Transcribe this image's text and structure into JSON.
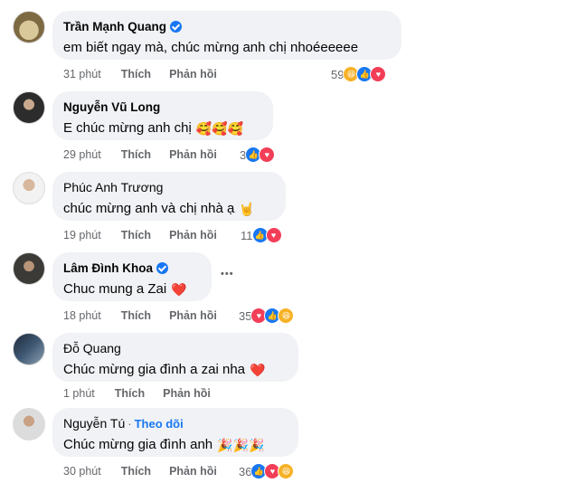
{
  "comments": [
    {
      "name": "Trần Mạnh Quang",
      "verified": true,
      "text": "em biết ngay mà, chúc mừng anh chị nhoéeeeee",
      "emojis": "",
      "time": "31 phút",
      "like_label": "Thích",
      "reply_label": "Phản hồi",
      "reaction_count": "59",
      "reactions": [
        "haha-icon",
        "like-icon",
        "love-icon"
      ]
    },
    {
      "name": "Nguyễn Vũ Long",
      "verified": false,
      "text": "E chúc mừng anh chị",
      "emojis": "🥰🥰🥰",
      "time": "29 phút",
      "like_label": "Thích",
      "reply_label": "Phản hồi",
      "reaction_count": "3",
      "reactions": [
        "like-icon",
        "love-icon"
      ]
    },
    {
      "name": "Phúc Anh Trương",
      "verified": false,
      "text": "chúc mừng anh và chị nhà ạ",
      "emojis": "🤘",
      "time": "19 phút",
      "like_label": "Thích",
      "reply_label": "Phản hồi",
      "reaction_count": "11",
      "reactions": [
        "like-icon",
        "love-icon"
      ]
    },
    {
      "name": "Lâm Đình Khoa",
      "verified": true,
      "text": "Chuc mung a Zai",
      "emojis": "❤️",
      "time": "18 phút",
      "like_label": "Thích",
      "reply_label": "Phản hồi",
      "reaction_count": "35",
      "reactions": [
        "love-icon",
        "like-icon",
        "haha-icon"
      ],
      "more_label": "•••"
    },
    {
      "name": "Đỗ Quang",
      "verified": false,
      "text": "Chúc mừng gia đình a zai nha",
      "emojis": "❤️",
      "time": "1 phút",
      "like_label": "Thích",
      "reply_label": "Phản hồi",
      "reaction_count": "",
      "reactions": []
    },
    {
      "name": "Nguyễn Tú",
      "verified": false,
      "follow_label": "Theo dõi",
      "separator": "·",
      "text": "Chúc mừng gia đình anh",
      "emojis": "🎉🎉🎉",
      "time": "30 phút",
      "like_label": "Thích",
      "reply_label": "Phản hồi",
      "reaction_count": "36",
      "reactions": [
        "like-icon",
        "love-icon",
        "haha-icon"
      ]
    }
  ],
  "colors": {
    "bubble": "#f0f2f5",
    "meta_text": "#65676b",
    "like": "#1877f2",
    "love": "#f33e58",
    "haha": "#f7b125"
  }
}
